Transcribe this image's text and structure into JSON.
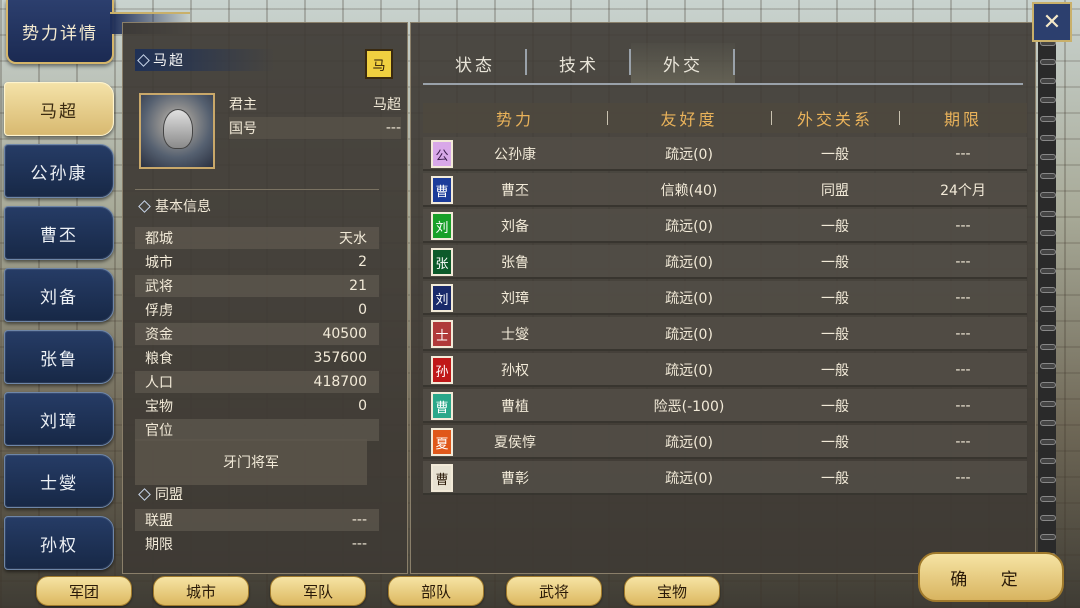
{
  "window_title": "势力详情",
  "sidebar": {
    "items": [
      {
        "label": "马超",
        "active": true
      },
      {
        "label": "公孙康"
      },
      {
        "label": "曹丕"
      },
      {
        "label": "刘备"
      },
      {
        "label": "张鲁"
      },
      {
        "label": "刘璋"
      },
      {
        "label": "士燮"
      },
      {
        "label": "孙权"
      }
    ]
  },
  "leader": {
    "name": "马超",
    "flag_char": "马",
    "ruler_label": "君主",
    "ruler_value": "马超",
    "country_label": "国号",
    "country_value": "---"
  },
  "basic_info": {
    "heading": "基本信息",
    "rows": [
      {
        "label": "都城",
        "value": "天水"
      },
      {
        "label": "城市",
        "value": "2"
      },
      {
        "label": "武将",
        "value": "21"
      },
      {
        "label": "俘虏",
        "value": "0"
      },
      {
        "label": "资金",
        "value": "40500"
      },
      {
        "label": "粮食",
        "value": "357600"
      },
      {
        "label": "人口",
        "value": "418700"
      },
      {
        "label": "宝物",
        "value": "0"
      },
      {
        "label": "官位",
        "value": ""
      }
    ],
    "officer_title": "牙门将军"
  },
  "alliance": {
    "heading": "同盟",
    "rows": [
      {
        "label": "联盟",
        "value": "---"
      },
      {
        "label": "期限",
        "value": "---"
      }
    ]
  },
  "tabs": [
    {
      "label": "状态"
    },
    {
      "label": "技术"
    },
    {
      "label": "外交",
      "active": true
    }
  ],
  "diplomacy": {
    "headers": [
      "势力",
      "友好度",
      "外交关系",
      "期限"
    ],
    "rows": [
      {
        "flag": "公",
        "flag_color": "#d8a8e8",
        "flag_text_color": "#3a1a4a",
        "force": "公孙康",
        "friendship": "疏远(0)",
        "relation": "一般",
        "term": "---"
      },
      {
        "flag": "曹",
        "flag_color": "#1c3c9a",
        "flag_text_color": "#ffffff",
        "force": "曹丕",
        "friendship": "信赖(40)",
        "relation": "同盟",
        "term": "24个月"
      },
      {
        "flag": "刘",
        "flag_color": "#18a028",
        "flag_text_color": "#ffffff",
        "force": "刘备",
        "friendship": "疏远(0)",
        "relation": "一般",
        "term": "---"
      },
      {
        "flag": "张",
        "flag_color": "#0c5a2a",
        "flag_text_color": "#ffffff",
        "force": "张鲁",
        "friendship": "疏远(0)",
        "relation": "一般",
        "term": "---"
      },
      {
        "flag": "刘",
        "flag_color": "#1a2a6a",
        "flag_text_color": "#ffffff",
        "force": "刘璋",
        "friendship": "疏远(0)",
        "relation": "一般",
        "term": "---"
      },
      {
        "flag": "士",
        "flag_color": "#b03a3a",
        "flag_text_color": "#ffffff",
        "force": "士燮",
        "friendship": "疏远(0)",
        "relation": "一般",
        "term": "---"
      },
      {
        "flag": "孙",
        "flag_color": "#c01818",
        "flag_text_color": "#ffffff",
        "force": "孙权",
        "friendship": "疏远(0)",
        "relation": "一般",
        "term": "---"
      },
      {
        "flag": "曹",
        "flag_color": "#2aa88a",
        "flag_text_color": "#ffffff",
        "force": "曹植",
        "friendship": "险恶(-100)",
        "relation": "一般",
        "term": "---"
      },
      {
        "flag": "夏",
        "flag_color": "#e0581a",
        "flag_text_color": "#ffffff",
        "force": "夏侯惇",
        "friendship": "疏远(0)",
        "relation": "一般",
        "term": "---"
      },
      {
        "flag": "曹",
        "flag_color": "#e8e2d2",
        "flag_text_color": "#2a1a08",
        "force": "曹彰",
        "friendship": "疏远(0)",
        "relation": "一般",
        "term": "---"
      }
    ]
  },
  "bottom_buttons": [
    "军团",
    "城市",
    "军队",
    "部队",
    "武将",
    "宝物"
  ],
  "confirm_label": "确 定",
  "close_icon": "crossed-swords-icon"
}
